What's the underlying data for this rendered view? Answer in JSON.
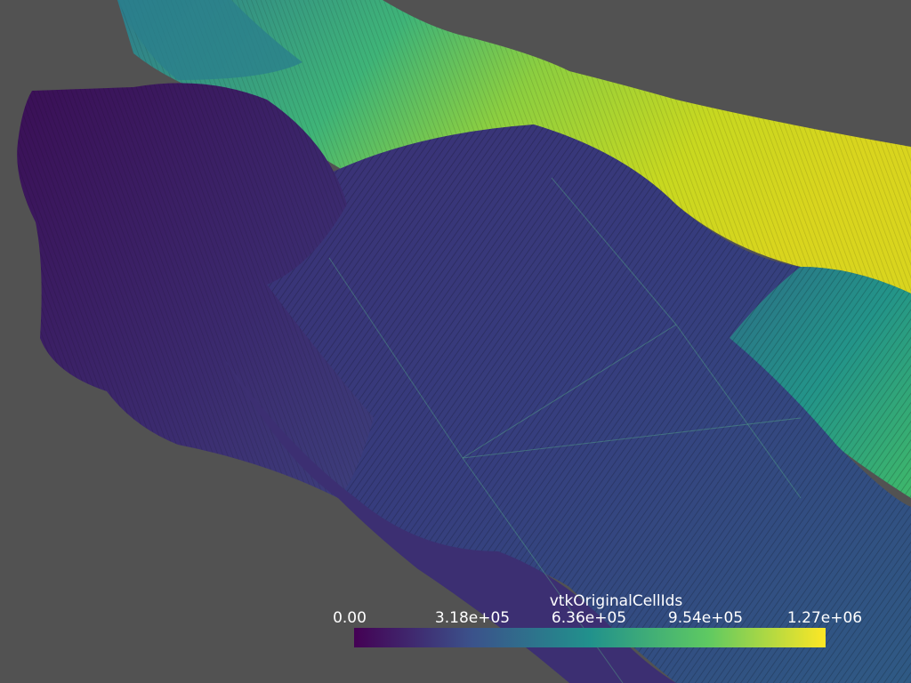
{
  "scalar_bar": {
    "title": "vtkOriginalCellIds",
    "labels": [
      "0.00",
      "3.18e+05",
      "6.36e+05",
      "9.54e+05",
      "1.27e+06"
    ],
    "range": [
      0,
      1270000
    ],
    "colormap": "viridis",
    "colors": [
      "#440154",
      "#3b528b",
      "#21918c",
      "#5ec962",
      "#fde725"
    ]
  },
  "viewport": {
    "background": "#525252",
    "mesh": "voxelized surface colored by cell id"
  }
}
